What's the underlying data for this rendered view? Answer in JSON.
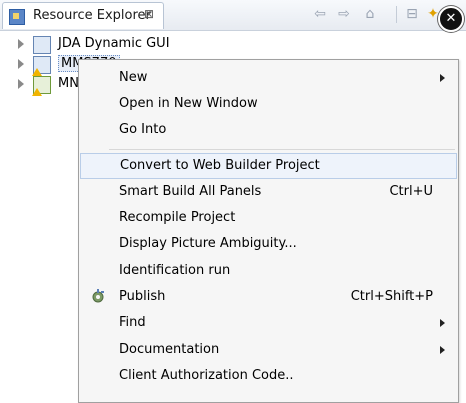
{
  "view": {
    "title": "Resource Explorer",
    "close_glyph": "⊠",
    "toolbar_icons": [
      "back-arrow-icon",
      "forward-arrow-icon",
      "home-icon",
      "collapse-all-icon",
      "new-icon"
    ],
    "overlay_close_icon": "close-icon"
  },
  "tree": {
    "items": [
      {
        "label": "JDA Dynamic GUI",
        "icon": "project-icon"
      },
      {
        "label": "MMS770",
        "icon": "project-warning-icon",
        "selected": true
      },
      {
        "label": "MN",
        "icon": "project-warning-icon"
      }
    ]
  },
  "context_menu": {
    "items": [
      {
        "label": "New",
        "submenu": true
      },
      {
        "label": "Open in New Window"
      },
      {
        "label": "Go Into"
      },
      {
        "separator": true
      },
      {
        "label": "Convert to Web Builder Project",
        "highlighted": true
      },
      {
        "label": "Smart Build All Panels",
        "shortcut": "Ctrl+U"
      },
      {
        "label": "Recompile Project"
      },
      {
        "label": "Display Picture Ambiguity..."
      },
      {
        "label": "Identification run"
      },
      {
        "label": "Publish",
        "shortcut": "Ctrl+Shift+P",
        "icon": "publish-gear-icon"
      },
      {
        "label": "Find",
        "submenu": true
      },
      {
        "label": "Documentation",
        "submenu": true
      },
      {
        "label": "Client Authorization Code.."
      }
    ]
  },
  "colors": {
    "highlight_bg": "#eef3fb",
    "highlight_border": "#b9cde8",
    "menu_bg": "#f6f6f6"
  }
}
